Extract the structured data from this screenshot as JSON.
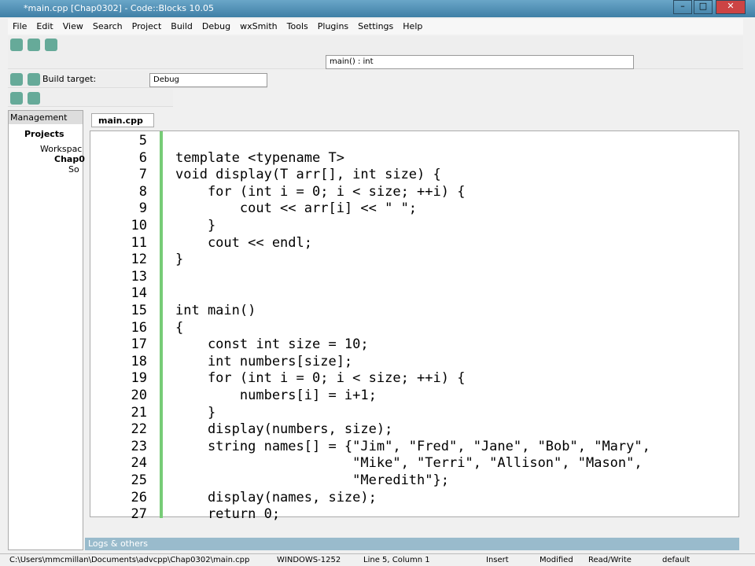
{
  "title": "*main.cpp [Chap0302] - Code::Blocks 10.05",
  "menu": [
    "File",
    "Edit",
    "View",
    "Search",
    "Project",
    "Build",
    "Debug",
    "wxSmith",
    "Tools",
    "Plugins",
    "Settings",
    "Help"
  ],
  "func_select": "main() : int",
  "build_label": "Build target:",
  "build_target": "Debug",
  "mgmt": {
    "title": "Management",
    "tab": "Projects",
    "tree": [
      "Workspac",
      "Chap0",
      "So"
    ]
  },
  "file_tab": "main.cpp",
  "logs": "Logs & others",
  "code": [
    [
      "5",
      ""
    ],
    [
      "6",
      "template <typename T>"
    ],
    [
      "7",
      "void display(T arr[], int size) {"
    ],
    [
      "8",
      "    for (int i = 0; i < size; ++i) {"
    ],
    [
      "9",
      "        cout << arr[i] << \" \";"
    ],
    [
      "10",
      "    }"
    ],
    [
      "11",
      "    cout << endl;"
    ],
    [
      "12",
      "}"
    ],
    [
      "13",
      ""
    ],
    [
      "14",
      ""
    ],
    [
      "15",
      "int main()"
    ],
    [
      "16",
      "{"
    ],
    [
      "17",
      "    const int size = 10;"
    ],
    [
      "18",
      "    int numbers[size];"
    ],
    [
      "19",
      "    for (int i = 0; i < size; ++i) {"
    ],
    [
      "20",
      "        numbers[i] = i+1;"
    ],
    [
      "21",
      "    }"
    ],
    [
      "22",
      "    display(numbers, size);"
    ],
    [
      "23",
      "    string names[] = {\"Jim\", \"Fred\", \"Jane\", \"Bob\", \"Mary\","
    ],
    [
      "24",
      "                      \"Mike\", \"Terri\", \"Allison\", \"Mason\","
    ],
    [
      "25",
      "                      \"Meredith\"};"
    ],
    [
      "26",
      "    display(names, size);"
    ],
    [
      "27",
      "    return 0;"
    ]
  ],
  "status": {
    "path": "C:\\Users\\mmcmillan\\Documents\\advcpp\\Chap0302\\main.cpp",
    "enc": "WINDOWS-1252",
    "pos": "Line 5, Column 1",
    "mode": "Insert",
    "mod": "Modified",
    "rw": "Read/Write",
    "def": "default"
  }
}
